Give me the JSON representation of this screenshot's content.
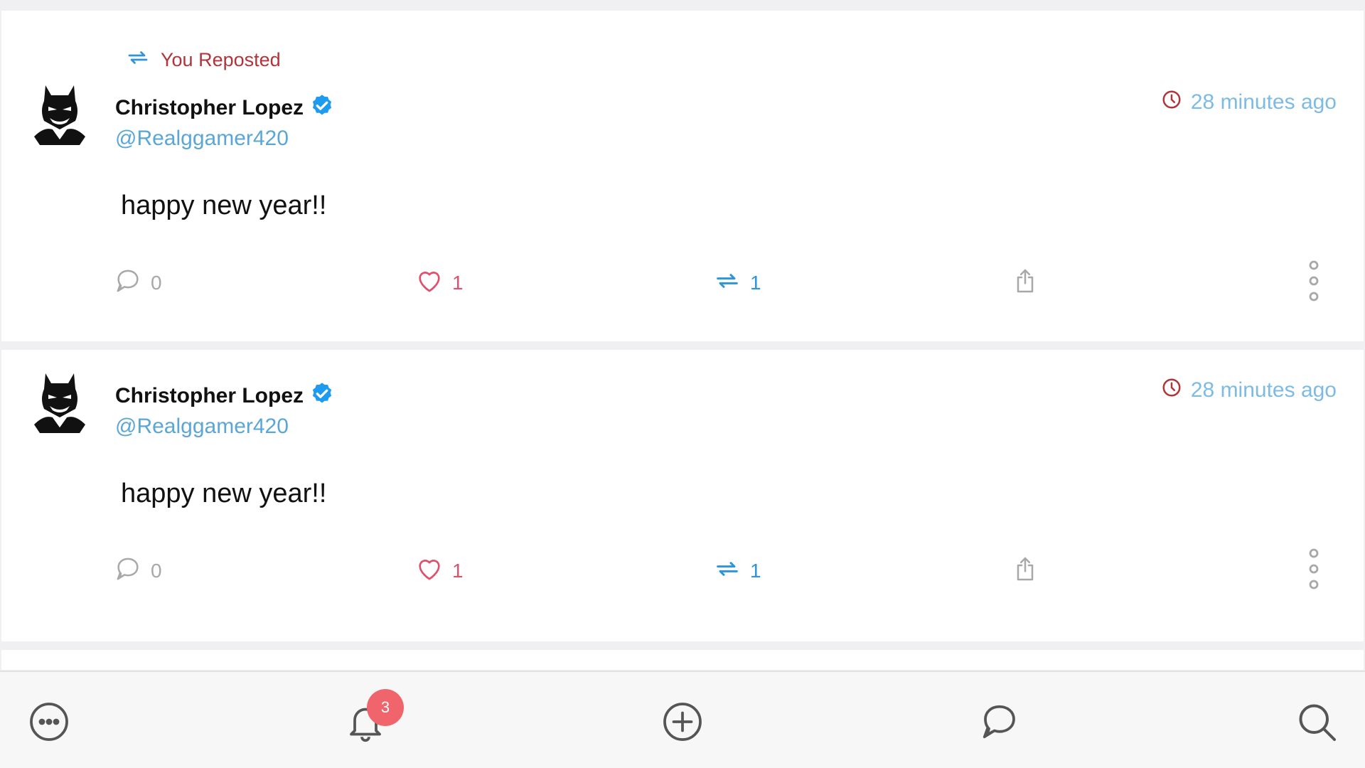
{
  "posts": [
    {
      "repost_label": "You Reposted",
      "display_name": "Christopher Lopez",
      "handle": "@Realggamer420",
      "time": "28 minutes ago",
      "text": "happy new year!!",
      "reply_count": "0",
      "like_count": "1",
      "repost_count": "1",
      "verified": true
    },
    {
      "display_name": "Christopher Lopez",
      "handle": "@Realggamer420",
      "time": "28 minutes ago",
      "text": "happy new year!!",
      "reply_count": "0",
      "like_count": "1",
      "repost_count": "1",
      "verified": true
    }
  ],
  "tabbar": {
    "items": [
      "menu-icon",
      "bell-icon",
      "compose-icon",
      "messages-icon",
      "search-icon"
    ],
    "notification_badge": "3"
  },
  "colors": {
    "handle": "#5aa6d6",
    "repost_label": "#b3333a",
    "like": "#e0506a",
    "repost": "#2f95d6",
    "badge": "#f0656b",
    "verified": "#1d9bf0"
  }
}
